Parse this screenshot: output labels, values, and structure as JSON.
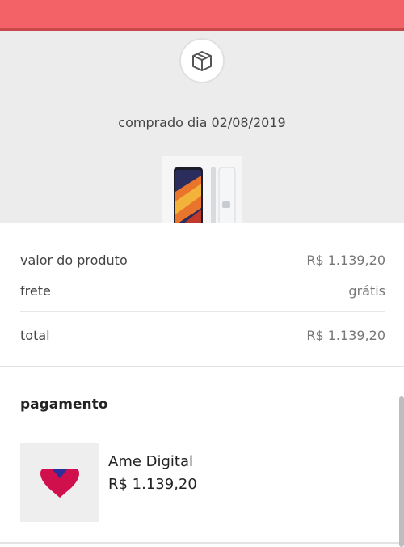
{
  "header": {
    "icon": "box-icon",
    "purchase_date": "comprado dia 02/08/2019",
    "product_image": "smartphone-product-image"
  },
  "summary": {
    "rows": [
      {
        "label": "valor do produto",
        "value": "R$ 1.139,20"
      },
      {
        "label": "frete",
        "value": "grátis"
      },
      {
        "label": "total",
        "value": "R$ 1.139,20"
      }
    ]
  },
  "payment": {
    "title": "pagamento",
    "method_name": "Ame Digital",
    "amount": "R$ 1.139,20",
    "logo": "ame-digital-logo"
  },
  "colors": {
    "brand_red": "#f26266",
    "header_bg": "#ececec"
  }
}
